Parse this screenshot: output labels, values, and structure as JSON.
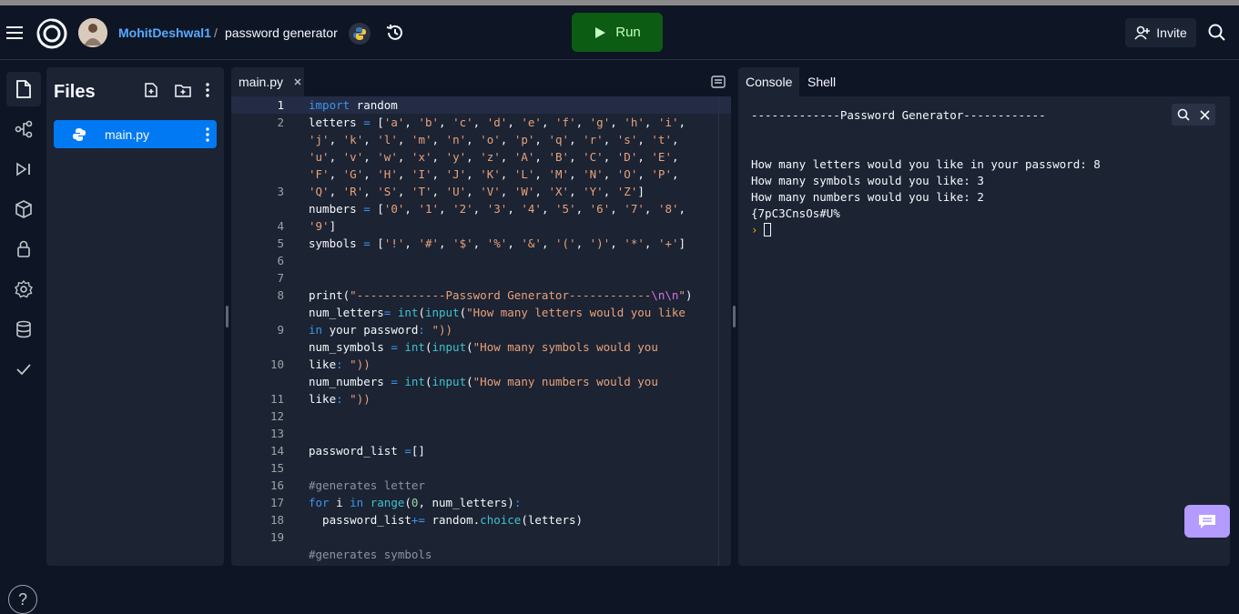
{
  "header": {
    "username": "MohitDeshwal1",
    "separator": "/",
    "repl_name": "password generator",
    "run_label": "Run",
    "invite_label": "Invite"
  },
  "sidebar": {
    "title": "Files",
    "files": [
      {
        "name": "main.py"
      }
    ],
    "help_label": "?"
  },
  "editor": {
    "tab_label": "main.py",
    "line_numbers": [
      "1",
      "2",
      "",
      "",
      "",
      "3",
      "",
      "4",
      "5",
      "6",
      "7",
      "8",
      "",
      "9",
      "",
      "10",
      "",
      "11",
      "12",
      "13",
      "14",
      "15",
      "16",
      "17",
      "18",
      "19"
    ],
    "lines": [
      "import random",
      "letters = ['a', 'b', 'c', 'd', 'e', 'f', 'g', 'h', 'i',",
      "'j', 'k', 'l', 'm', 'n', 'o', 'p', 'q', 'r', 's', 't',",
      "'u', 'v', 'w', 'x', 'y', 'z', 'A', 'B', 'C', 'D', 'E',",
      "'F', 'G', 'H', 'I', 'J', 'K', 'L', 'M', 'N', 'O', 'P',",
      "'Q', 'R', 'S', 'T', 'U', 'V', 'W', 'X', 'Y', 'Z']",
      "numbers = ['0', '1', '2', '3', '4', '5', '6', '7', '8',",
      "'9']",
      "symbols = ['!', '#', '$', '%', '&', '(', ')', '*', '+']",
      "",
      "",
      "print(\"-------------Password Generator------------\\n\\n\")",
      "num_letters= int(input(\"How many letters would you like",
      "in your password: \"))",
      "num_symbols = int(input(\"How many symbols would you",
      "like: \"))",
      "num_numbers = int(input(\"How many numbers would you",
      "like: \"))",
      "",
      "",
      "password_list =[]",
      "",
      "#generates letter",
      "for i in range(0, num_letters):",
      "  password_list+= random.choice(letters)",
      "",
      "#generates symbols"
    ]
  },
  "console": {
    "tabs": [
      "Console",
      "Shell"
    ],
    "output": [
      "-------------Password Generator------------",
      "",
      "",
      "How many letters would you like in your password: 8",
      "How many symbols would you like: 3",
      "How many numbers would you like: 2",
      "{7pC3CnsOs#U%"
    ],
    "prompt_symbol": "›"
  }
}
